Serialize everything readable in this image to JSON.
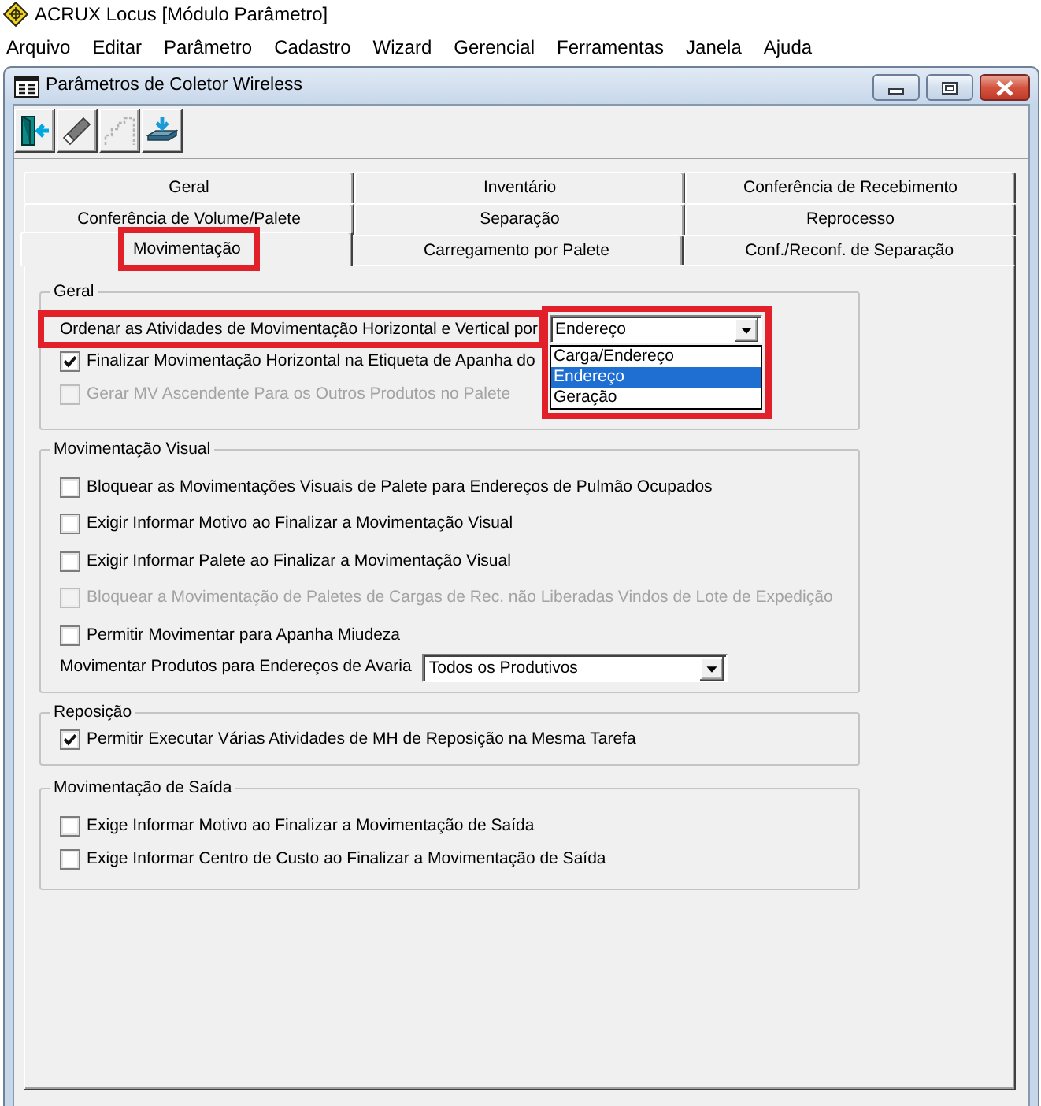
{
  "app": {
    "title": "ACRUX Locus [Módulo Parâmetro]"
  },
  "menu": [
    "Arquivo",
    "Editar",
    "Parâmetro",
    "Cadastro",
    "Wizard",
    "Gerencial",
    "Ferramentas",
    "Janela",
    "Ajuda"
  ],
  "window": {
    "title": "Parâmetros de Coletor Wireless"
  },
  "toolbar": [
    {
      "kind": "door",
      "disabled": false
    },
    {
      "kind": "eraser",
      "disabled": false
    },
    {
      "kind": "stairs",
      "disabled": true
    },
    {
      "kind": "tray",
      "disabled": false
    }
  ],
  "tab_rows": [
    {
      "tabs": [
        {
          "label": "Geral",
          "selected": false,
          "highlighted": false
        },
        {
          "label": "Inventário",
          "selected": false,
          "highlighted": false
        },
        {
          "label": "Conferência de Recebimento",
          "selected": false,
          "highlighted": false
        }
      ]
    },
    {
      "tabs": [
        {
          "label": "Conferência de Volume/Palete",
          "selected": false,
          "highlighted": false
        },
        {
          "label": "Separação",
          "selected": false,
          "highlighted": false
        },
        {
          "label": "Reprocesso",
          "selected": false,
          "highlighted": false
        }
      ]
    },
    {
      "tabs": [
        {
          "label": "Movimentação",
          "selected": true,
          "highlighted": true
        },
        {
          "label": "Carregamento por Palete",
          "selected": false,
          "highlighted": false
        },
        {
          "label": "Conf./Reconf. de Separação",
          "selected": false,
          "highlighted": false
        }
      ]
    }
  ],
  "groups": [
    {
      "title": "Geral",
      "rows": [
        {
          "kind": "select",
          "label": "Ordenar as Atividades de Movimentação Horizontal e Vertical por",
          "label_highlighted": true,
          "value": "Endereço",
          "highlighted": true,
          "options": [
            {
              "label": "Carga/Endereço",
              "selected": false
            },
            {
              "label": "Endereço",
              "selected": true
            },
            {
              "label": "Geração",
              "selected": false
            }
          ]
        },
        {
          "kind": "checkbox",
          "label": "Finalizar Movimentação Horizontal na Etiqueta de Apanha do",
          "checked": true,
          "disabled": false
        },
        {
          "kind": "checkbox",
          "label": "Gerar MV Ascendente Para os Outros Produtos no Palete",
          "checked": false,
          "disabled": true
        }
      ]
    },
    {
      "title": "Movimentação Visual",
      "rows": [
        {
          "kind": "checkbox",
          "label": "Bloquear as Movimentações Visuais de Palete para Endereços de Pulmão Ocupados",
          "checked": false,
          "disabled": false
        },
        {
          "kind": "checkbox",
          "label": "Exigir Informar Motivo ao Finalizar a Movimentação Visual",
          "checked": false,
          "disabled": false
        },
        {
          "kind": "checkbox",
          "label": "Exigir Informar Palete ao Finalizar a Movimentação Visual",
          "checked": false,
          "disabled": false
        },
        {
          "kind": "checkbox",
          "label": "Bloquear a Movimentação de Paletes de Cargas de Rec. não Liberadas Vindos de Lote de Expedição",
          "checked": false,
          "disabled": true
        },
        {
          "kind": "checkbox",
          "label": "Permitir Movimentar para Apanha Miudeza",
          "checked": false,
          "disabled": false
        },
        {
          "kind": "select",
          "label": "Movimentar Produtos para Endereços de Avaria",
          "value": "Todos os Produtivos"
        }
      ]
    },
    {
      "title": "Reposição",
      "rows": [
        {
          "kind": "checkbox",
          "label": "Permitir Executar Várias Atividades de MH de Reposição na Mesma Tarefa",
          "checked": true,
          "disabled": false
        }
      ]
    },
    {
      "title": "Movimentação de Saída",
      "rows": [
        {
          "kind": "checkbox",
          "label": "Exige Informar Motivo ao Finalizar a Movimentação de Saída",
          "checked": false,
          "disabled": false
        },
        {
          "kind": "checkbox",
          "label": "Exige Informar Centro de Custo ao Finalizar a Movimentação de Saída",
          "checked": false,
          "disabled": false
        }
      ]
    }
  ]
}
